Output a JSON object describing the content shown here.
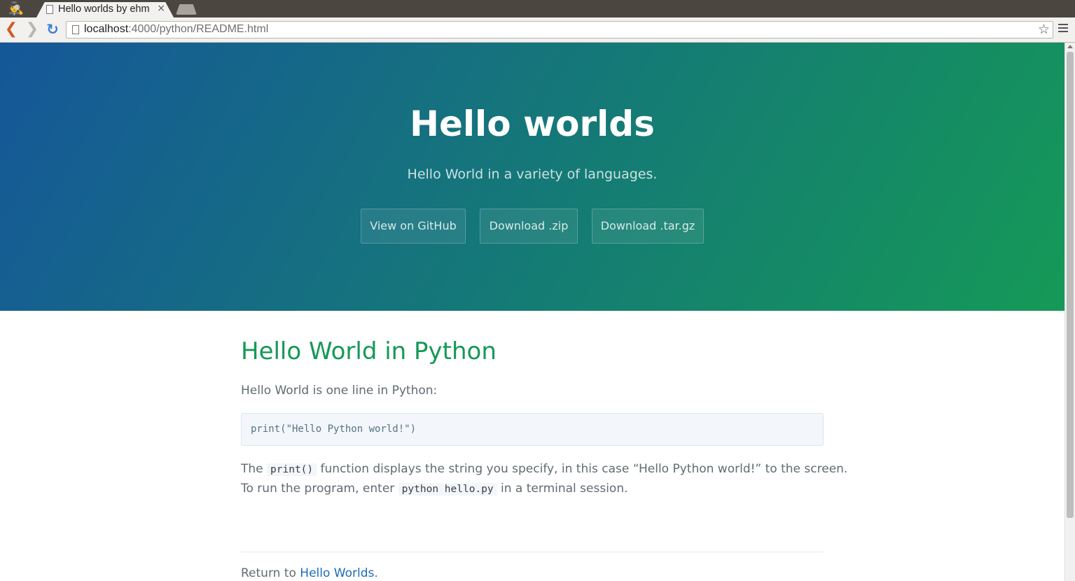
{
  "browser": {
    "tab_title": "Hello worlds by ehm",
    "tab_close": "×",
    "url_host": "localhost",
    "url_rest": ":4000/python/README.html",
    "star_glyph": "☆",
    "back_glyph": "❮",
    "forward_glyph": "❯",
    "reload_glyph": "↻",
    "incognito_glyph": "🕵"
  },
  "hero": {
    "title": "Hello worlds",
    "tagline": "Hello World in a variety of languages.",
    "buttons": [
      {
        "label": "View on GitHub"
      },
      {
        "label": "Download .zip"
      },
      {
        "label": "Download .tar.gz"
      }
    ],
    "gradient": [
      "#155799",
      "#159957"
    ]
  },
  "content": {
    "heading": "Hello World in Python",
    "intro": "Hello World is one line in Python:",
    "code": "print(\"Hello Python world!\")",
    "desc_line1_a": "The ",
    "desc_code1": "print()",
    "desc_line1_b": " function displays the string you specify, in this case “Hello Python world!” to the screen.",
    "desc_line2_a": "To run the program, enter ",
    "desc_code2": "python hello.py",
    "desc_line2_b": " in a terminal session.",
    "return_prefix": "Return to ",
    "return_link": "Hello Worlds",
    "return_suffix": "."
  },
  "colors": {
    "heading": "#159957",
    "link": "#1e6bb8",
    "text": "#606c71"
  }
}
